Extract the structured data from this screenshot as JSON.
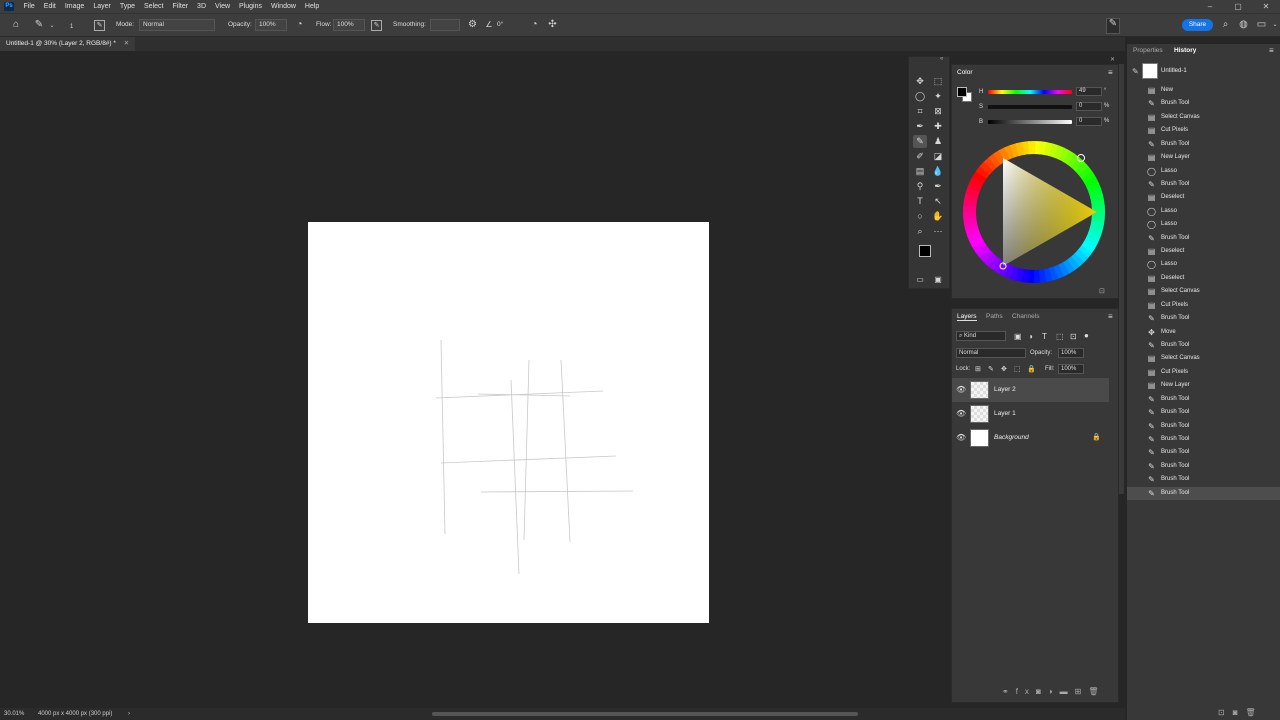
{
  "menu": {
    "logo": "Ps",
    "items": [
      "File",
      "Edit",
      "Image",
      "Layer",
      "Type",
      "Select",
      "Filter",
      "3D",
      "View",
      "Plugins",
      "Window",
      "Help"
    ],
    "window_controls": [
      "–",
      "▢",
      "✕"
    ]
  },
  "options": {
    "brush_size": "1",
    "mode_label": "Mode:",
    "mode_value": "Normal",
    "opacity_label": "Opacity:",
    "opacity_value": "100%",
    "flow_label": "Flow:",
    "flow_value": "100%",
    "smoothing_label": "Smoothing:",
    "smoothing_value": "",
    "angle_value": "0°",
    "share_label": "Share"
  },
  "document": {
    "tab_title": "Untitled-1 @ 30% (Layer 2, RGB/8#) *",
    "zoom": "30.01%",
    "info": "4000 px x 4000 px (300 ppi)",
    "status_arrow": "›"
  },
  "color_panel": {
    "title": "Color",
    "h_label": "H",
    "h_value": "49",
    "h_unit": "°",
    "s_label": "S",
    "s_value": "0",
    "s_unit": "%",
    "b_label": "B",
    "b_value": "0",
    "b_unit": "%",
    "menu_icon": "≡"
  },
  "layers_panel": {
    "tabs": [
      "Layers",
      "Paths",
      "Channels"
    ],
    "kind_label": "Kind",
    "blend_mode": "Normal",
    "opacity_label": "Opacity:",
    "opacity_value": "100%",
    "lock_label": "Lock:",
    "fill_label": "Fill:",
    "fill_value": "100%",
    "layers": [
      {
        "name": "Layer 2",
        "selected": true,
        "transparent": true
      },
      {
        "name": "Layer 1",
        "selected": false,
        "transparent": true
      },
      {
        "name": "Background",
        "selected": false,
        "transparent": false,
        "locked": true
      }
    ]
  },
  "history_panel": {
    "tabs": [
      "Properties",
      "History"
    ],
    "snapshot_name": "Untitled-1",
    "steps": [
      "New",
      "Brush Tool",
      "Select Canvas",
      "Cut Pixels",
      "Brush Tool",
      "New Layer",
      "Lasso",
      "Brush Tool",
      "Deselect",
      "Lasso",
      "Lasso",
      "Brush Tool",
      "Deselect",
      "Lasso",
      "Deselect",
      "Select Canvas",
      "Cut Pixels",
      "Brush Tool",
      "Move",
      "Brush Tool",
      "Select Canvas",
      "Cut Pixels",
      "New Layer",
      "Brush Tool",
      "Brush Tool",
      "Brush Tool",
      "Brush Tool",
      "Brush Tool",
      "Brush Tool",
      "Brush Tool",
      "Brush Tool"
    ],
    "step_icons": [
      "doc",
      "brush",
      "doc",
      "doc",
      "brush",
      "doc",
      "lasso",
      "brush",
      "doc",
      "lasso",
      "lasso",
      "brush",
      "doc",
      "lasso",
      "doc",
      "doc",
      "doc",
      "brush",
      "move",
      "brush",
      "doc",
      "doc",
      "doc",
      "brush",
      "brush",
      "brush",
      "brush",
      "brush",
      "brush",
      "brush",
      "brush"
    ]
  },
  "colors": {
    "accent": "#1473e6",
    "foreground": "#000000",
    "background": "#ffffff"
  }
}
